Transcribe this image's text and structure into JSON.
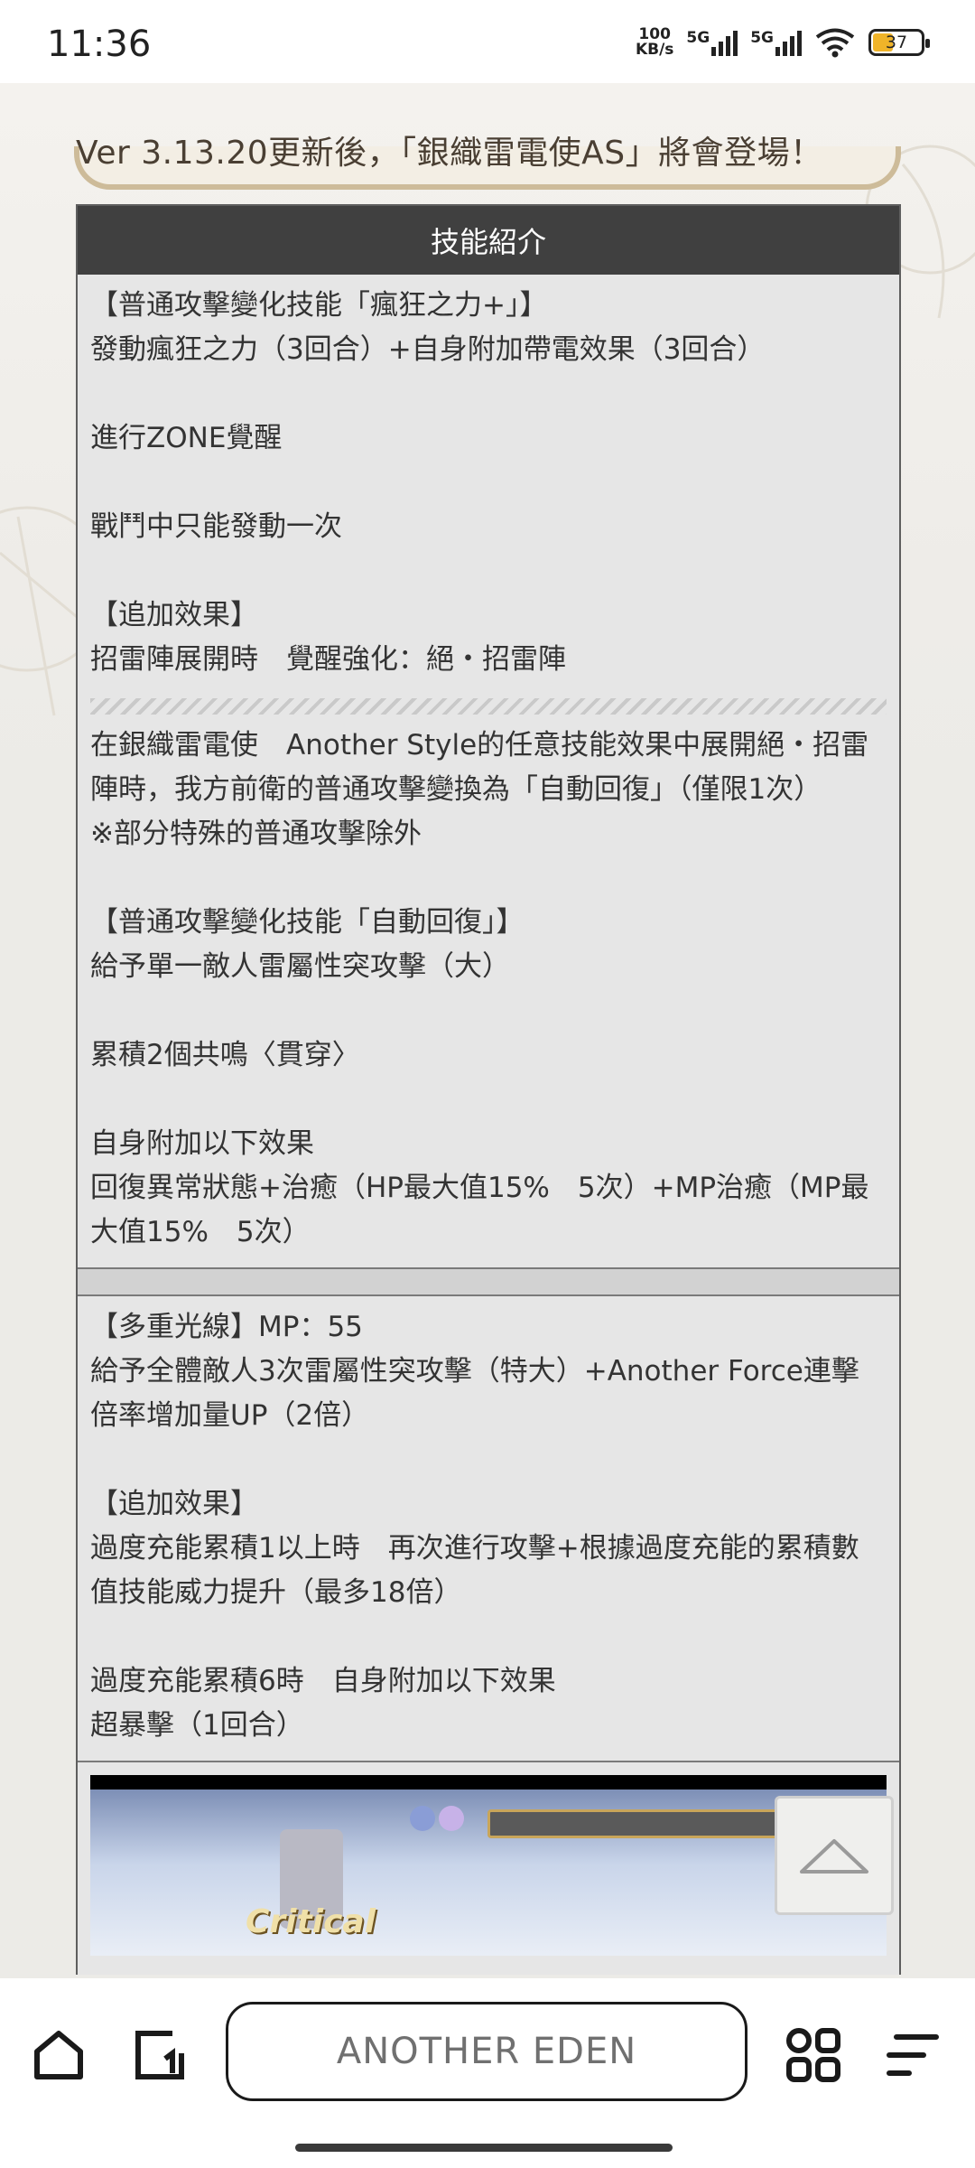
{
  "status_bar": {
    "time": "11:36",
    "speed_value": "100",
    "speed_unit": "KB/s",
    "net1": "5G",
    "net2": "5G",
    "battery": "37"
  },
  "headline": "Ver 3.13.20更新後，「銀織雷電使AS」將會登場！",
  "table": {
    "header": "技能紹介",
    "section1": [
      "【普通攻擊變化技能「瘋狂之力+」】",
      "發動瘋狂之力（3回合）+自身附加帶電效果（3回合）",
      "",
      "進行ZONE覺醒",
      "",
      "戰鬥中只能發動一次",
      "",
      "【追加效果】",
      "招雷陣展開時　覺醒強化：絕・招雷陣"
    ],
    "section2": [
      "在銀織雷電使　Another Style的任意技能效果中展開絕・招雷陣時，我方前衛的普通攻擊變換為「自動回復」（僅限1次）",
      "※部分特殊的普通攻擊除外",
      "",
      "【普通攻擊變化技能「自動回復」】",
      "給予單一敵人雷屬性突攻擊（大）",
      "",
      "累積2個共鳴〈貫穿〉",
      "",
      "自身附加以下效果",
      "回復異常狀態+治癒（HP最大值15%　5次）+MP治癒（MP最大值15%　5次）"
    ],
    "section3": [
      "【多重光線】MP：55",
      "給予全體敵人3次雷屬性突攻擊（特大）+Another Force連擊倍率增加量UP（2倍）",
      "",
      "【追加效果】",
      "過度充能累積1以上時　再次進行攻擊+根據過度充能的累積數值技能威力提升（最多18倍）",
      "",
      "過度充能累積6時　自身附加以下效果",
      "超暴擊（1回合）"
    ],
    "image_caption": "Critical"
  },
  "browser": {
    "url_text": "ANOTHER EDEN"
  },
  "icons": {
    "home": "home-icon",
    "tabs": "tabs-icon",
    "apps": "apps-grid-icon",
    "menu": "menu-icon",
    "back_to_top": "chevron-up-icon"
  }
}
